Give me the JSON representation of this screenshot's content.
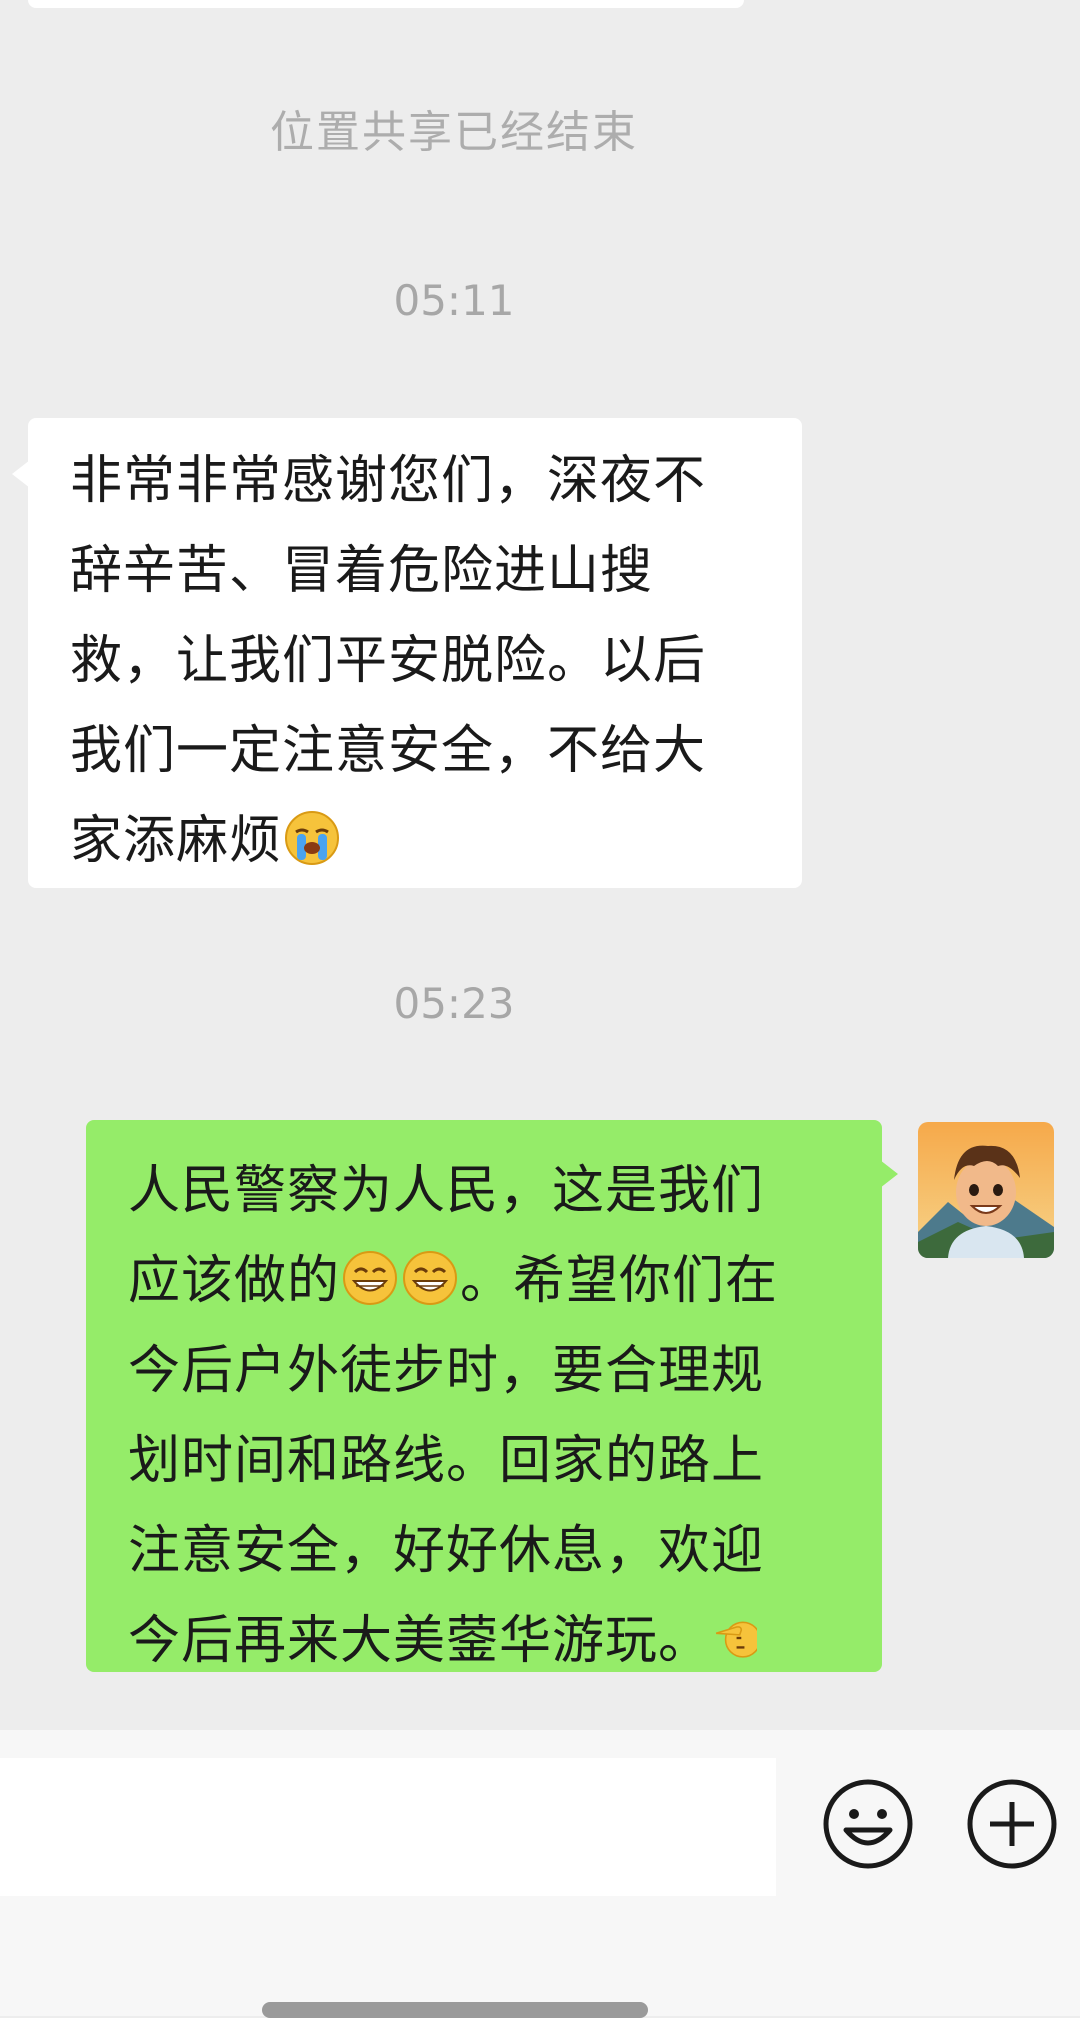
{
  "chat": {
    "system_notice": "位置共享已经结束",
    "timestamps": [
      "05:11",
      "05:23"
    ],
    "messages": [
      {
        "direction": "incoming",
        "lines": [
          "非常非常感谢您们，深夜不",
          "辞辛苦、冒着危险进山搜",
          "救，让我们平安脱险。以后",
          "我们一定注意安全，不给大",
          "家添麻烦"
        ],
        "trailing_emoji": "crying-emoji"
      },
      {
        "direction": "outgoing",
        "lines": [
          "人民警察为人民，这是我们",
          "应该做的",
          "。希望你们在",
          "今后户外徒步时，要合理规",
          "划时间和路线。回家的路上",
          "注意安全，好好休息，欢迎",
          "今后再来大美蓥华游玩。"
        ],
        "emojis": [
          "grin-emoji",
          "grin-emoji",
          "salute-emoji"
        ]
      }
    ]
  },
  "input_bar": {
    "placeholder": "",
    "emoji_icon": "emoji-face-icon",
    "plus_icon": "plus-circle-icon"
  },
  "colors": {
    "background": "#ededed",
    "outgoing_bubble": "#95ec69",
    "incoming_bubble": "#ffffff",
    "meta_text": "#a7a7a7"
  }
}
